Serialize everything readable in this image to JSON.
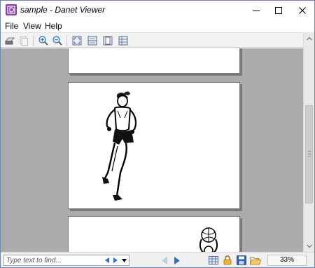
{
  "window": {
    "title": "sample - Danet Viewer"
  },
  "menu": {
    "items": [
      "File",
      "View",
      "Help"
    ]
  },
  "toolbar": {
    "buttons": [
      "print-icon",
      "copy-icon",
      "zoom-in-icon",
      "zoom-out-icon",
      "fit-page-icon",
      "fit-width-icon",
      "single-page-icon",
      "two-page-icon"
    ]
  },
  "statusbar": {
    "find_placeholder": "Type text to find...",
    "zoom": "33%"
  },
  "colors": {
    "app_icon": "#8a3fa6",
    "viewport_bg": "#ababab",
    "nav_arrow": "#2c6fc4"
  }
}
